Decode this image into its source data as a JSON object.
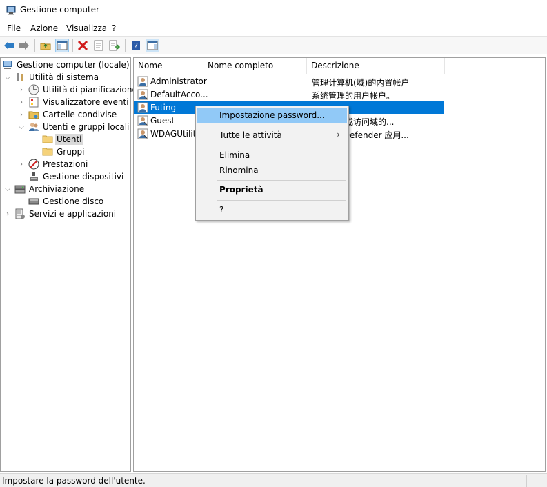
{
  "window": {
    "title": "Gestione computer",
    "icon": "computer-management-icon"
  },
  "menu": [
    {
      "label": "File"
    },
    {
      "label": "Azione"
    },
    {
      "label": "Visualizza"
    },
    {
      "label": "?"
    }
  ],
  "toolbar": {
    "buttons": [
      "back-arrow-icon",
      "forward-arrow-icon",
      "up-folder-icon",
      "show-hide-tree-icon",
      "delete-icon",
      "properties-icon",
      "export-list-icon",
      "help-icon",
      "action-pane-icon"
    ]
  },
  "tree": [
    {
      "label": "Gestione computer (locale)",
      "icon": "computer-management-icon"
    },
    {
      "label": "Utilità di sistema",
      "icon": "tools-icon"
    },
    {
      "label": "Utilità di pianificazione",
      "icon": "clock-icon"
    },
    {
      "label": "Visualizzatore eventi",
      "icon": "event-viewer-icon"
    },
    {
      "label": "Cartelle condivise",
      "icon": "shared-folder-icon"
    },
    {
      "label": "Utenti e gruppi locali",
      "icon": "users-icon"
    },
    {
      "label": "Utenti",
      "icon": "folder-icon"
    },
    {
      "label": "Gruppi",
      "icon": "folder-icon"
    },
    {
      "label": "Prestazioni",
      "icon": "performance-icon"
    },
    {
      "label": "Gestione dispositivi",
      "icon": "device-manager-icon"
    },
    {
      "label": "Archiviazione",
      "icon": "storage-icon"
    },
    {
      "label": "Gestione disco",
      "icon": "disk-icon"
    },
    {
      "label": "Servizi e applicazioni",
      "icon": "services-icon"
    }
  ],
  "list": {
    "columns": [
      "Nome",
      "Nome completo",
      "Descrizione"
    ],
    "rows": [
      {
        "name": "Administrator",
        "full_name": "",
        "description": "管理计算机(域)的内置帐户"
      },
      {
        "name": "DefaultAcco...",
        "full_name": "",
        "description": "系统管理的用户帐户。"
      },
      {
        "name": "Futing",
        "full_name": "",
        "description": ""
      },
      {
        "name": "Guest",
        "full_name": "",
        "description": "问计算机或访问域的..."
      },
      {
        "name": "WDAGUtility",
        "full_name": "",
        "description": "indows Defender 应用..."
      }
    ]
  },
  "context_menu": {
    "items": [
      {
        "label": "Impostazione password..."
      },
      {
        "label": "Tutte le attività"
      },
      {
        "label": "Elimina"
      },
      {
        "label": "Rinomina"
      },
      {
        "label": "Proprietà"
      },
      {
        "label": "?"
      }
    ]
  },
  "status": {
    "text": "Impostare la password dell'utente."
  },
  "colors": {
    "selection": "#0078d7",
    "menu_hover": "#91c9f7"
  }
}
